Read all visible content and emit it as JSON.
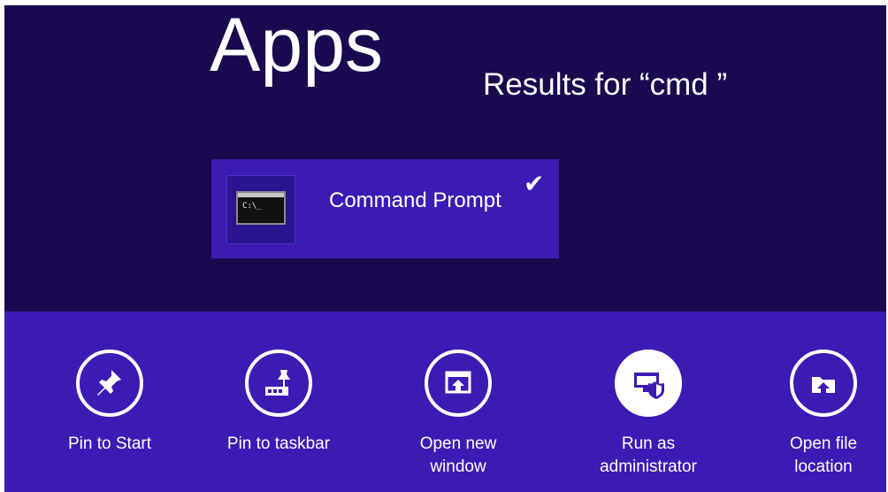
{
  "search": {
    "category": "Apps",
    "results_text": "Results for “cmd ”"
  },
  "result": {
    "label": "Command Prompt",
    "selected": true,
    "selected_indicator": "✔",
    "icon": "command-prompt-icon",
    "icon_text": "C:\\_"
  },
  "commands": [
    {
      "label": "Pin to Start",
      "icon": "pin-icon"
    },
    {
      "label": "Pin to taskbar",
      "icon": "taskbar-pin-icon"
    },
    {
      "label": "Open new\nwindow",
      "icon": "new-window-icon"
    },
    {
      "label": "Run as\nadministrator",
      "icon": "shield-admin-icon"
    },
    {
      "label": "Open file\nlocation",
      "icon": "folder-location-icon"
    }
  ],
  "colors": {
    "search_background": "#190a4f",
    "accent": "#3b1bb3",
    "text": "#ffffff"
  }
}
